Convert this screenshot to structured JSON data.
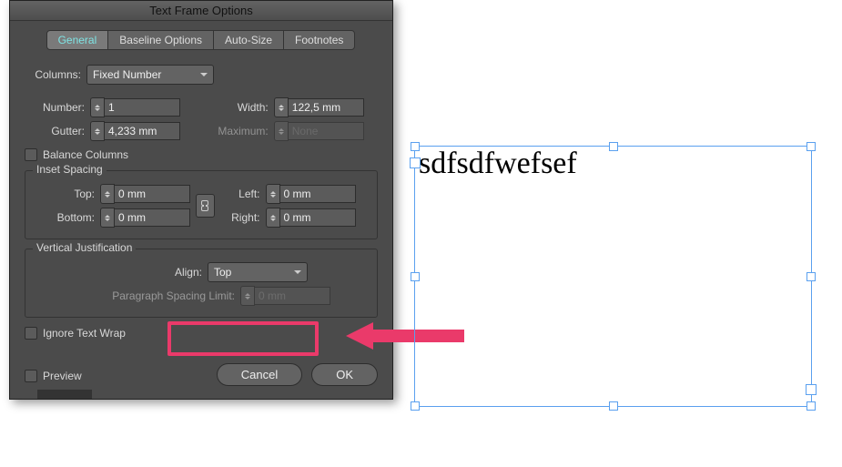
{
  "dialog": {
    "title": "Text Frame Options",
    "tabs": [
      "General",
      "Baseline Options",
      "Auto-Size",
      "Footnotes"
    ],
    "activeTab": 0,
    "columns": {
      "label": "Columns:",
      "typeValue": "Fixed Number",
      "numberLabel": "Number:",
      "numberValue": "1",
      "widthLabel": "Width:",
      "widthValue": "122,5 mm",
      "gutterLabel": "Gutter:",
      "gutterValue": "4,233 mm",
      "maximumLabel": "Maximum:",
      "maximumValue": "None",
      "balanceLabel": "Balance Columns"
    },
    "inset": {
      "title": "Inset Spacing",
      "topLabel": "Top:",
      "topValue": "0 mm",
      "bottomLabel": "Bottom:",
      "bottomValue": "0 mm",
      "leftLabel": "Left:",
      "leftValue": "0 mm",
      "rightLabel": "Right:",
      "rightValue": "0 mm"
    },
    "vjust": {
      "title": "Vertical Justification",
      "alignLabel": "Align:",
      "alignValue": "Top",
      "paraLimitLabel": "Paragraph Spacing Limit:",
      "paraLimitValue": "0 mm"
    },
    "ignoreWrapLabel": "Ignore Text Wrap",
    "previewLabel": "Preview",
    "cancelLabel": "Cancel",
    "okLabel": "OK"
  },
  "textFrame": {
    "content": "sdfsdfwefsef"
  }
}
